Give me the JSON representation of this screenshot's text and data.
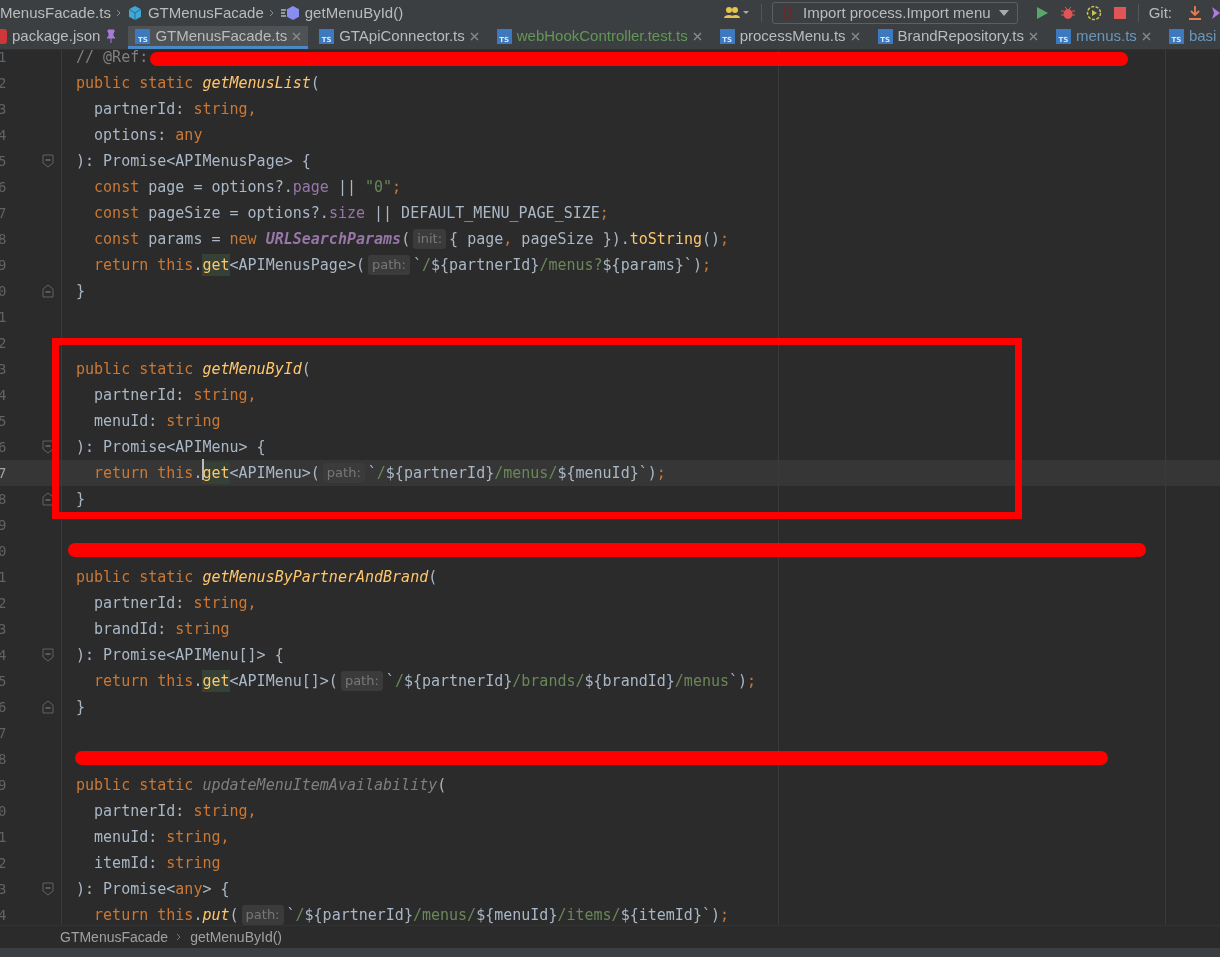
{
  "breadcrumb": [
    {
      "kind": "file",
      "label": "MenusFacade.ts"
    },
    {
      "kind": "class",
      "label": "GTMenusFacade"
    },
    {
      "kind": "method",
      "label": "getMenuById()"
    }
  ],
  "toolbar": {
    "run_config": "Import process.Import menu",
    "git_label": "Git:"
  },
  "tabs": [
    {
      "label": "package.json",
      "kind": "npm",
      "selected": false,
      "color": "#bbbbbb",
      "pinned": true
    },
    {
      "label": "GTMenusFacade.ts",
      "kind": "ts",
      "icon_text": "TS",
      "selected": true,
      "color": "#bbbbbb",
      "pinned": false
    },
    {
      "label": "GTApiConnector.ts",
      "kind": "ts",
      "icon_text": "TS",
      "selected": false,
      "color": "#bbbbbb",
      "pinned": false
    },
    {
      "label": "webHookController.test.ts",
      "kind": "ts",
      "icon_text": "TS",
      "selected": false,
      "color": "#629755",
      "pinned": false
    },
    {
      "label": "processMenu.ts",
      "kind": "ts",
      "icon_text": "TS",
      "selected": false,
      "color": "#bbbbbb",
      "pinned": false
    },
    {
      "label": "BrandRepository.ts",
      "kind": "ts",
      "icon_text": "TS",
      "selected": false,
      "color": "#bbbbbb",
      "pinned": false
    },
    {
      "label": "menus.ts",
      "kind": "ts",
      "icon_text": "TS",
      "selected": false,
      "color": "#6897bb",
      "pinned": false
    },
    {
      "label": "basi",
      "kind": "ts",
      "icon_text": "TS",
      "selected": false,
      "color": "#6897bb"
    }
  ],
  "lines": [
    {
      "n": "1",
      "current": false,
      "tokens": [
        {
          "kind": "comment",
          "text": "// @Ref:"
        }
      ]
    },
    {
      "n": "2",
      "current": false,
      "tokens": [
        {
          "kind": "kw",
          "text": "public static "
        },
        {
          "kind": "fn",
          "text": "getMenusList"
        },
        {
          "kind": "plain",
          "text": "("
        }
      ]
    },
    {
      "n": "3",
      "current": false,
      "tokens": [
        {
          "kind": "plain",
          "text": "  partnerId: "
        },
        {
          "kind": "kw",
          "text": "string,"
        }
      ]
    },
    {
      "n": "4",
      "current": false,
      "tokens": [
        {
          "kind": "plain",
          "text": "  options: "
        },
        {
          "kind": "kw",
          "text": "any"
        }
      ]
    },
    {
      "n": "5",
      "kind": "open",
      "current": false,
      "tokens": [
        {
          "kind": "plain",
          "text": "): Promise<APIMenusPage> {"
        }
      ]
    },
    {
      "n": "6",
      "current": false,
      "tokens": [
        {
          "kind": "kw",
          "text": "  const "
        },
        {
          "kind": "plain",
          "text": "page = options?."
        },
        {
          "kind": "prop",
          "text": "page"
        },
        {
          "kind": "plain",
          "text": " || "
        },
        {
          "kind": "str",
          "text": "\"0\""
        },
        {
          "kind": "kw",
          "text": ";"
        }
      ]
    },
    {
      "n": "7",
      "current": false,
      "tokens": [
        {
          "kind": "kw",
          "text": "  const "
        },
        {
          "kind": "plain",
          "text": "pageSize = options?."
        },
        {
          "kind": "prop",
          "text": "size"
        },
        {
          "kind": "plain",
          "text": " || DEFAULT_MENU_PAGE_SIZE"
        },
        {
          "kind": "kw",
          "text": ";"
        }
      ]
    },
    {
      "n": "8",
      "current": false,
      "tokens": [
        {
          "kind": "kw",
          "text": "  const "
        },
        {
          "kind": "plain",
          "text": "params = "
        },
        {
          "kind": "kw",
          "text": "new "
        },
        {
          "kind": "cls",
          "text": "URLSearchParams"
        },
        {
          "kind": "plain",
          "text": "("
        },
        {
          "kind": "hint",
          "text": "init:"
        },
        {
          "kind": "plain",
          "text": "{ page"
        },
        {
          "kind": "kw",
          "text": ","
        },
        {
          "kind": "plain",
          "text": " pageSize })."
        },
        {
          "kind": "call",
          "text": "toString"
        },
        {
          "kind": "plain",
          "text": "()"
        },
        {
          "kind": "kw",
          "text": ";"
        }
      ]
    },
    {
      "n": "9",
      "current": false,
      "tokens": [
        {
          "kind": "kw",
          "text": "  return this"
        },
        {
          "kind": "plain",
          "text": "."
        },
        {
          "kind": "hl",
          "text": "get"
        },
        {
          "kind": "plain",
          "text": "<APIMenusPage>("
        },
        {
          "kind": "hint",
          "text": "path:"
        },
        {
          "kind": "plain",
          "text": "`"
        },
        {
          "kind": "str",
          "text": "/"
        },
        {
          "kind": "plain",
          "text": "${partnerId}"
        },
        {
          "kind": "str",
          "text": "/menus?"
        },
        {
          "kind": "plain",
          "text": "${params}`)"
        },
        {
          "kind": "kw",
          "text": ";"
        }
      ]
    },
    {
      "n": "0",
      "kind": "close",
      "current": false,
      "tokens": [
        {
          "kind": "plain",
          "text": "}"
        }
      ]
    },
    {
      "n": "1"
    },
    {
      "n": "2"
    },
    {
      "n": "3",
      "current": false,
      "tokens": [
        {
          "kind": "kw",
          "text": "public static "
        },
        {
          "kind": "fn",
          "text": "getMenuById"
        },
        {
          "kind": "plain",
          "text": "("
        }
      ]
    },
    {
      "n": "4",
      "current": false,
      "tokens": [
        {
          "kind": "plain",
          "text": "  partnerId: "
        },
        {
          "kind": "kw",
          "text": "string,"
        }
      ]
    },
    {
      "n": "5",
      "current": false,
      "tokens": [
        {
          "kind": "plain",
          "text": "  menuId: "
        },
        {
          "kind": "kw",
          "text": "string"
        }
      ]
    },
    {
      "n": "6",
      "kind": "open",
      "current": false,
      "tokens": [
        {
          "kind": "plain",
          "text": "): Promise<APIMenu> {"
        }
      ]
    },
    {
      "n": "7",
      "current": true,
      "tokens": [
        {
          "kind": "kw",
          "text": "  return this"
        },
        {
          "kind": "plain",
          "text": "."
        },
        {
          "kind": "hl",
          "text": "get"
        },
        {
          "kind": "plain",
          "text": "<APIMenu>("
        },
        {
          "kind": "hint",
          "text": "path:"
        },
        {
          "kind": "plain",
          "text": "`"
        },
        {
          "kind": "str",
          "text": "/"
        },
        {
          "kind": "plain",
          "text": "${partnerId}"
        },
        {
          "kind": "str",
          "text": "/menus/"
        },
        {
          "kind": "plain",
          "text": "${menuId}`)"
        },
        {
          "kind": "kw",
          "text": ";"
        }
      ]
    },
    {
      "n": "8",
      "kind": "close",
      "current": false,
      "tokens": [
        {
          "kind": "plain",
          "text": "}"
        }
      ]
    },
    {
      "n": "9"
    },
    {
      "n": "0"
    },
    {
      "n": "1",
      "current": false,
      "tokens": [
        {
          "kind": "kw",
          "text": "public static "
        },
        {
          "kind": "fn",
          "text": "getMenusByPartnerAndBrand"
        },
        {
          "kind": "plain",
          "text": "("
        }
      ]
    },
    {
      "n": "2",
      "current": false,
      "tokens": [
        {
          "kind": "plain",
          "text": "  partnerId: "
        },
        {
          "kind": "kw",
          "text": "string,"
        }
      ]
    },
    {
      "n": "3",
      "current": false,
      "tokens": [
        {
          "kind": "plain",
          "text": "  brandId: "
        },
        {
          "kind": "kw",
          "text": "string"
        }
      ]
    },
    {
      "n": "4",
      "kind": "open",
      "current": false,
      "tokens": [
        {
          "kind": "plain",
          "text": "): Promise<APIMenu[]> {"
        }
      ]
    },
    {
      "n": "5",
      "current": false,
      "tokens": [
        {
          "kind": "kw",
          "text": "  return this"
        },
        {
          "kind": "plain",
          "text": "."
        },
        {
          "kind": "hl",
          "text": "get"
        },
        {
          "kind": "plain",
          "text": "<APIMenu[]>("
        },
        {
          "kind": "hint",
          "text": "path:"
        },
        {
          "kind": "plain",
          "text": "`"
        },
        {
          "kind": "str",
          "text": "/"
        },
        {
          "kind": "plain",
          "text": "${partnerId}"
        },
        {
          "kind": "str",
          "text": "/brands/"
        },
        {
          "kind": "plain",
          "text": "${brandId}"
        },
        {
          "kind": "str",
          "text": "/menus"
        },
        {
          "kind": "plain",
          "text": "`)"
        },
        {
          "kind": "kw",
          "text": ";"
        }
      ]
    },
    {
      "n": "6",
      "kind": "close",
      "current": false,
      "tokens": [
        {
          "kind": "plain",
          "text": "}"
        }
      ]
    },
    {
      "n": "7"
    },
    {
      "n": "8"
    },
    {
      "n": "9",
      "current": false,
      "tokens": [
        {
          "kind": "kw",
          "text": "public static "
        },
        {
          "kind": "unused",
          "text": "updateMenuItemAvailability"
        },
        {
          "kind": "plain",
          "text": "("
        }
      ]
    },
    {
      "n": "0",
      "current": false,
      "tokens": [
        {
          "kind": "plain",
          "text": "  partnerId: "
        },
        {
          "kind": "kw",
          "text": "string,"
        }
      ]
    },
    {
      "n": "1",
      "current": false,
      "tokens": [
        {
          "kind": "plain",
          "text": "  menuId: "
        },
        {
          "kind": "kw",
          "text": "string,"
        }
      ]
    },
    {
      "n": "2",
      "current": false,
      "tokens": [
        {
          "kind": "plain",
          "text": "  itemId: "
        },
        {
          "kind": "kw",
          "text": "string"
        }
      ]
    },
    {
      "n": "3",
      "kind": "open",
      "current": false,
      "tokens": [
        {
          "kind": "plain",
          "text": "): Promise<"
        },
        {
          "kind": "kw",
          "text": "any"
        },
        {
          "kind": "plain",
          "text": "> {"
        }
      ]
    },
    {
      "n": "4",
      "current": false,
      "tokens": [
        {
          "kind": "kw",
          "text": "  return this"
        },
        {
          "kind": "plain",
          "text": "."
        },
        {
          "kind": "callu",
          "text": "put"
        },
        {
          "kind": "plain",
          "text": "("
        },
        {
          "kind": "hint",
          "text": "path:"
        },
        {
          "kind": "plain",
          "text": "`"
        },
        {
          "kind": "str",
          "text": "/"
        },
        {
          "kind": "plain",
          "text": "${partnerId}"
        },
        {
          "kind": "str",
          "text": "/menus/"
        },
        {
          "kind": "plain",
          "text": "${menuId}"
        },
        {
          "kind": "str",
          "text": "/items/"
        },
        {
          "kind": "plain",
          "text": "${itemId}`)"
        },
        {
          "kind": "kw",
          "text": ";"
        }
      ]
    }
  ],
  "status_breadcrumb": [
    "GTMenusFacade",
    "getMenuById()"
  ]
}
